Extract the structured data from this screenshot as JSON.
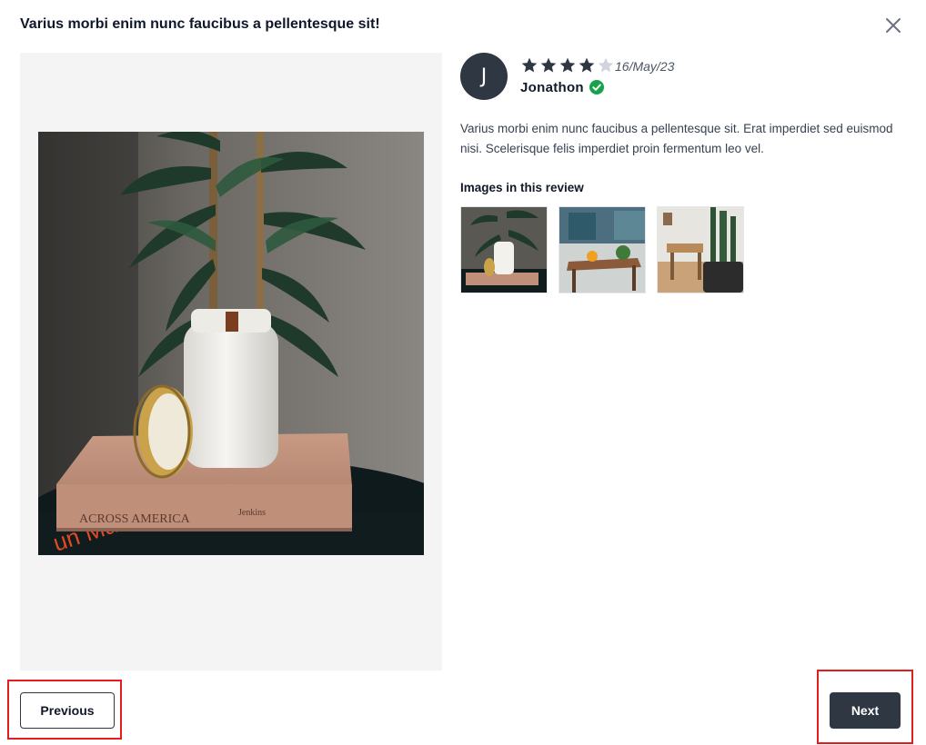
{
  "modal": {
    "title": "Varius morbi enim nunc faucibus a pellentesque sit!",
    "close_icon": "close-icon"
  },
  "review": {
    "avatar_initial": "J",
    "rating": 4,
    "rating_max": 5,
    "date": "16/May/23",
    "reviewer_name": "Jonathon",
    "verified_icon": "check-circle-icon",
    "body": "Varius morbi enim nunc faucibus a pellentesque sit. Erat imperdiet sed euismod nisi. Scelerisque felis imperdiet proin fermentum leo vel.",
    "images_heading": "Images in this review"
  },
  "navigation": {
    "previous_label": "Previous",
    "next_label": "Next"
  },
  "colors": {
    "primary_dark": "#2f3743",
    "star_filled": "#2f3743",
    "star_empty": "#d1d5db",
    "verified_green": "#16a34a",
    "highlight_red": "#e11d1d",
    "panel_bg": "#f4f4f4"
  }
}
